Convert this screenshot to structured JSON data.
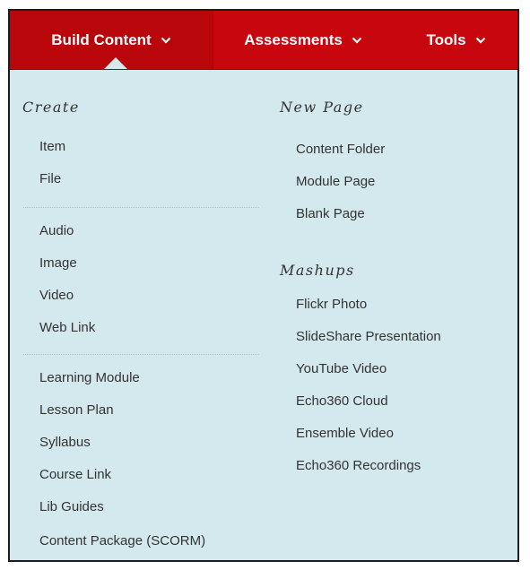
{
  "tabs": [
    {
      "label": "Build Content"
    },
    {
      "label": "Assessments"
    },
    {
      "label": "Tools"
    }
  ],
  "menu": {
    "create": {
      "heading": "Create",
      "group1": [
        "Item",
        "File"
      ],
      "group2": [
        "Audio",
        "Image",
        "Video",
        "Web Link"
      ],
      "group3": [
        "Learning Module",
        "Lesson Plan",
        "Syllabus",
        "Course Link",
        "Lib Guides",
        "Content Package (SCORM)"
      ]
    },
    "new_page": {
      "heading": "New Page",
      "items": [
        "Content Folder",
        "Module Page",
        "Blank Page"
      ]
    },
    "mashups": {
      "heading": "Mashups",
      "items": [
        "Flickr Photo",
        "SlideShare Presentation",
        "YouTube Video",
        "Echo360 Cloud",
        "Ensemble Video",
        "Echo360 Recordings"
      ]
    }
  },
  "icons": {
    "tab_dropdown": "chevron-down-icon"
  },
  "colors": {
    "tab_bar": "#c7070d",
    "menu_background": "#d3e9ee",
    "text": "#333333"
  }
}
